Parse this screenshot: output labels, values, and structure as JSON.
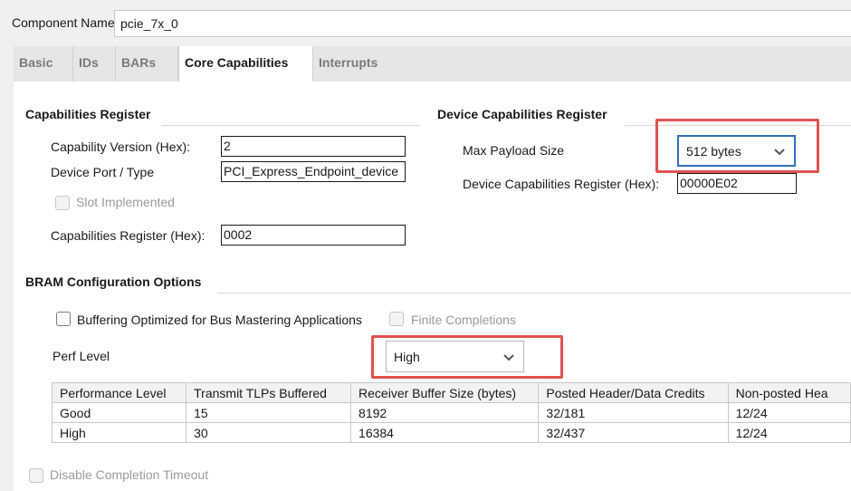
{
  "component": {
    "label": "Component Name",
    "value": "pcie_7x_0"
  },
  "tabs": [
    {
      "label": "Basic"
    },
    {
      "label": "IDs"
    },
    {
      "label": "BARs"
    },
    {
      "label": "Core Capabilities"
    },
    {
      "label": "Interrupts"
    }
  ],
  "caps_register": {
    "title": "Capabilities Register",
    "version_label": "Capability Version (Hex):",
    "version_value": "2",
    "port_label": "Device Port / Type",
    "port_value": "PCI_Express_Endpoint_device",
    "slot_label": "Slot Implemented",
    "reg_label": "Capabilities Register (Hex):",
    "reg_value": "0002"
  },
  "device_caps": {
    "title": "Device Capabilities Register",
    "max_payload_label": "Max Payload Size",
    "max_payload_value": "512 bytes",
    "reg_label": "Device Capabilities Register (Hex):",
    "reg_value": "00000E02"
  },
  "bram": {
    "title": "BRAM Configuration Options",
    "buffering_label": "Buffering Optimized for Bus Mastering Applications",
    "finite_label": "Finite Completions",
    "perf_label": "Perf Level",
    "perf_value": "High",
    "table": {
      "headers": [
        "Performance Level",
        "Transmit TLPs Buffered",
        "Receiver Buffer Size (bytes)",
        "Posted Header/Data Credits",
        "Non-posted Hea"
      ],
      "rows": [
        [
          "Good",
          "15",
          "8192",
          "32/181",
          "12/24"
        ],
        [
          "High",
          "30",
          "16384",
          "32/437",
          "12/24"
        ]
      ]
    }
  },
  "disable_timeout_label": "Disable Completion Timeout",
  "colors": {
    "highlight": "#e0524f",
    "focus_border": "#2f6fbf"
  }
}
